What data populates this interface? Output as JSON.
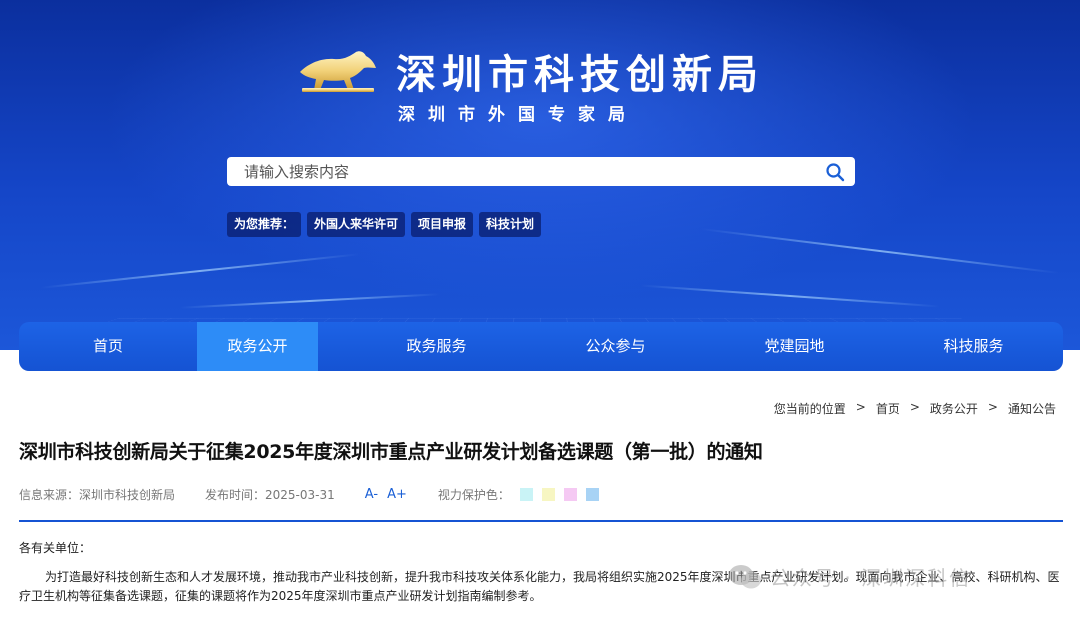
{
  "header": {
    "title": "深圳市科技创新局",
    "subtitle": "深圳市外国专家局",
    "logo_icon": "bull-icon",
    "brand_gold": "#f2d27a"
  },
  "search": {
    "placeholder": "请输入搜索内容",
    "icon": "search-icon"
  },
  "recommend": {
    "label": "为您推荐：",
    "items": [
      "外国人来华许可",
      "项目申报",
      "科技计划"
    ]
  },
  "nav": {
    "items": [
      "首页",
      "政务公开",
      "政务服务",
      "公众参与",
      "党建园地",
      "科技服务"
    ],
    "active": "政务公开"
  },
  "breadcrumb": {
    "prefix": "您当前的位置",
    "items": [
      "首页",
      "政务公开",
      "通知公告"
    ],
    "separator": ">"
  },
  "article": {
    "title": "深圳市科技创新局关于征集2025年度深圳市重点产业研发计划备选课题（第一批）的通知",
    "source": "信息来源：深圳市科技创新局",
    "date": "发布时间：2025-03-31",
    "font_smaller": "A-",
    "font_larger": "A+",
    "eye_care_label": "视力保护色：",
    "eye_care_colors": [
      "#c9f3f6",
      "#f7f6c2",
      "#f5c9f3",
      "#a8d3f5"
    ],
    "salutation": "各有关单位：",
    "paragraph": "为打造最好科技创新生态和人才发展环境，推动我市产业科技创新，提升我市科技攻关体系化能力，我局将组织实施2025年度深圳市重点产业研发计划。现面向我市企业、高校、科研机构、医疗卫生机构等征集备选课题，征集的课题将作为2025年度深圳市重点产业研发计划指南编制参考。"
  },
  "watermark": {
    "text": "公众号 · 深圳深科信",
    "icon": "wechat-icon"
  }
}
